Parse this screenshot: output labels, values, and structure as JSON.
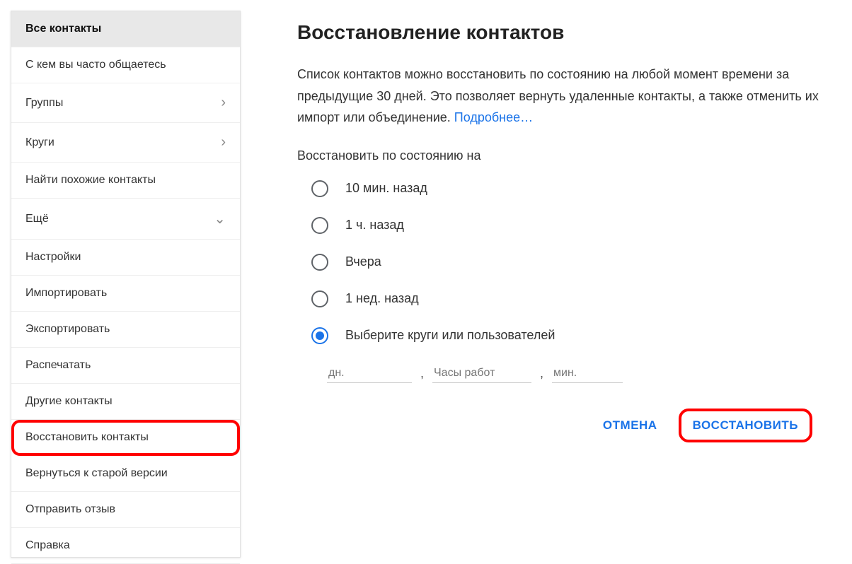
{
  "sidebar": {
    "items": [
      {
        "label": "Все контакты",
        "active": true
      },
      {
        "label": "С кем вы часто общаетесь"
      },
      {
        "label": "Группы",
        "chevron": "right"
      },
      {
        "label": "Круги",
        "chevron": "right"
      },
      {
        "label": "Найти похожие контакты"
      },
      {
        "label": "Ещё",
        "chevron": "down"
      },
      {
        "label": "Настройки"
      },
      {
        "label": "Импортировать"
      },
      {
        "label": "Экспортировать"
      },
      {
        "label": "Распечатать"
      },
      {
        "label": "Другие контакты"
      },
      {
        "label": "Восстановить контакты",
        "highlighted": true
      },
      {
        "label": "Вернуться к старой версии"
      },
      {
        "label": "Отправить отзыв"
      },
      {
        "label": "Справка"
      }
    ]
  },
  "main": {
    "title": "Восстановление контактов",
    "description": "Список контактов можно восстановить по состоянию на любой момент времени за предыдущие 30 дней. Это позволяет вернуть удаленные контакты, а также отменить их импорт или объединение. ",
    "more_link": "Подробнее…",
    "subheading": "Восстановить по состоянию на",
    "options": {
      "o1": "10 мин. назад",
      "o2": "1 ч. назад",
      "o3": "Вчера",
      "o4": "1 нед. назад",
      "o5": "Выберите круги или пользователей"
    },
    "inputs": {
      "days_placeholder": "дн.",
      "hours_placeholder": "Часы работ",
      "mins_placeholder": "мин."
    },
    "actions": {
      "cancel": "ОТМЕНА",
      "restore": "ВОССТАНОВИТЬ"
    }
  }
}
